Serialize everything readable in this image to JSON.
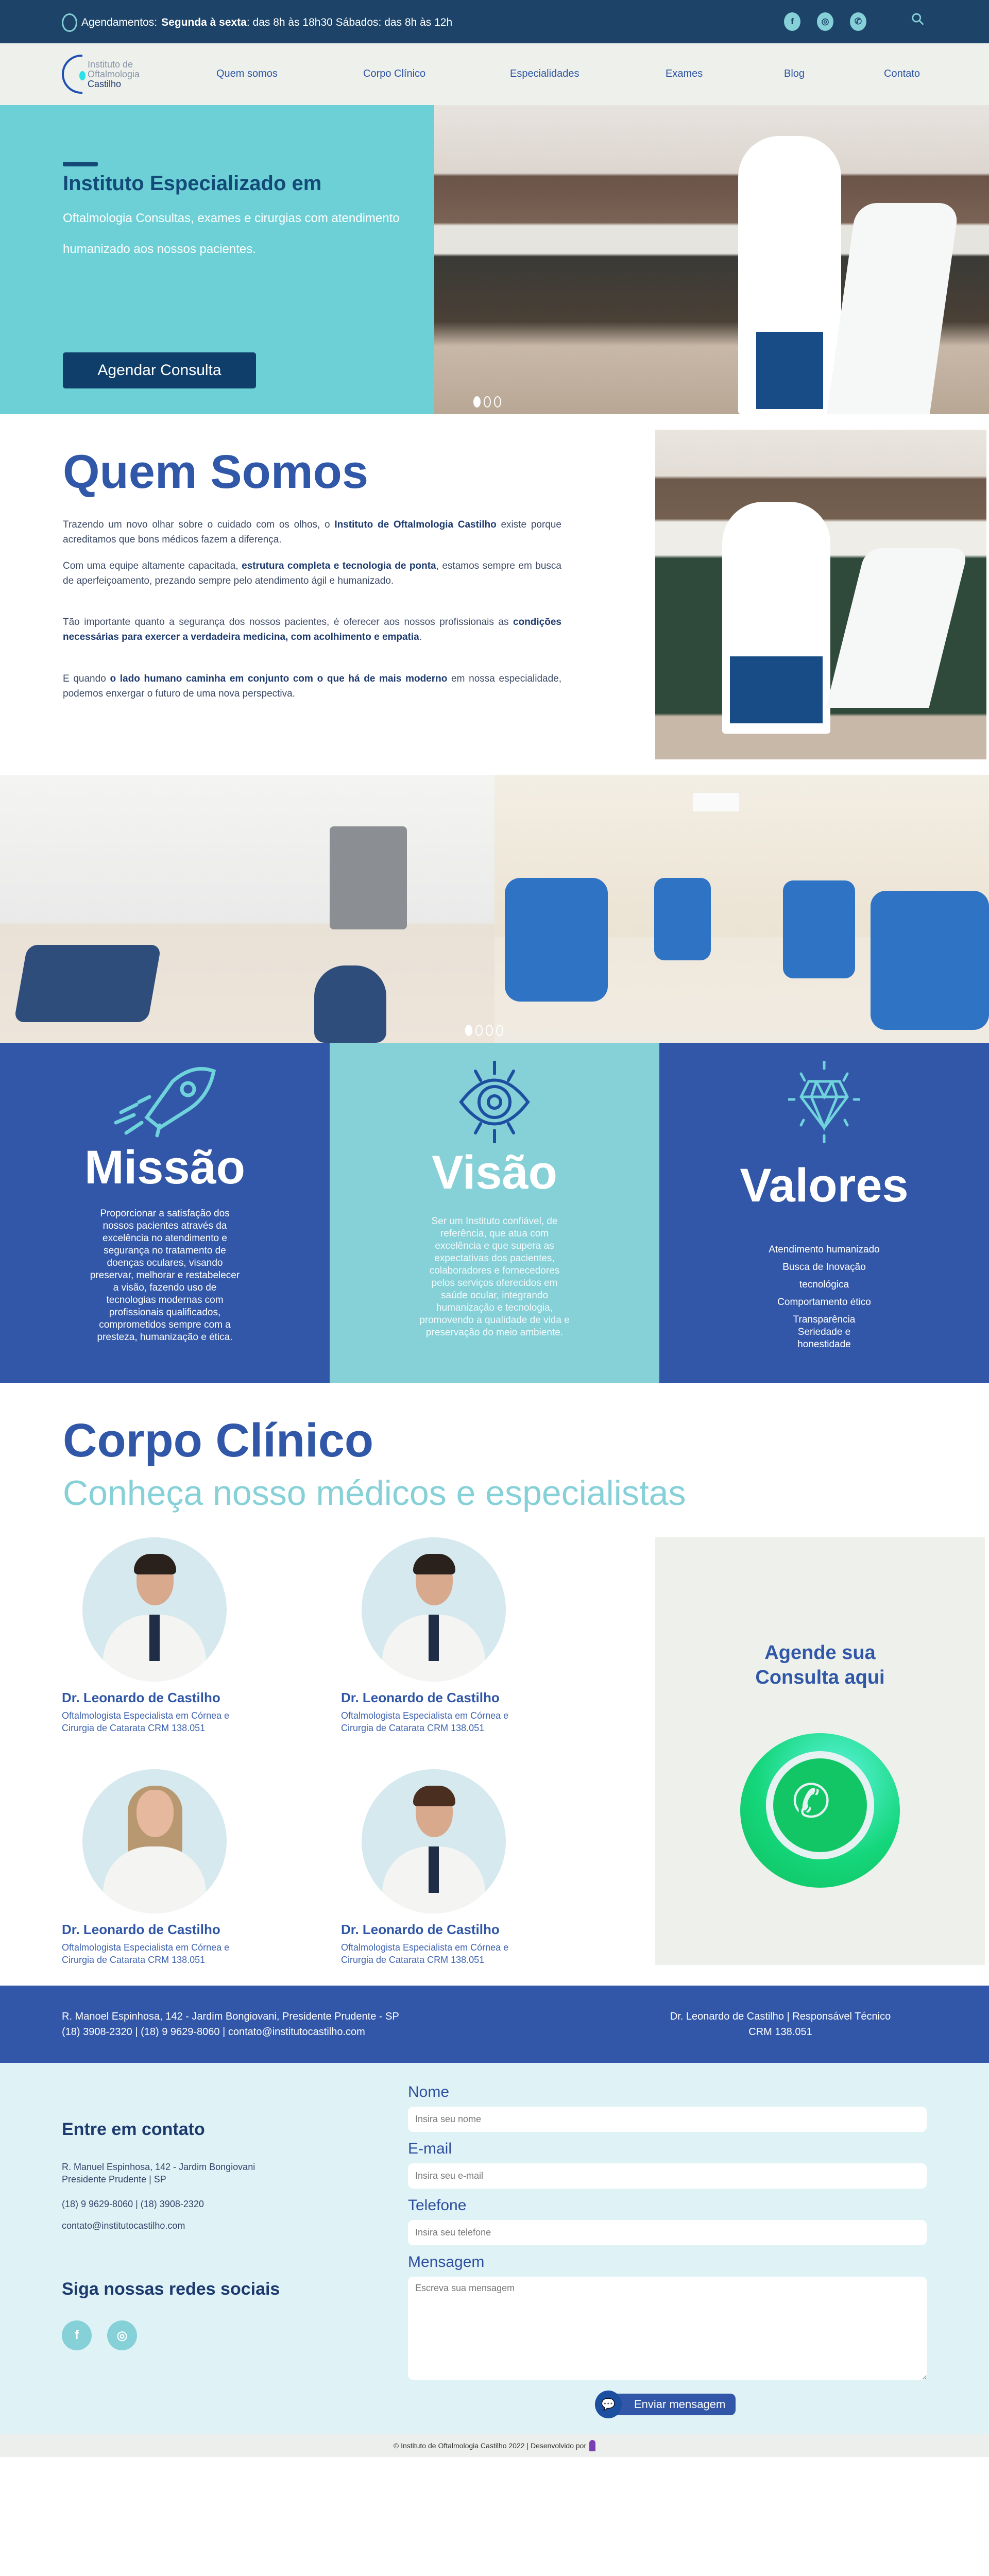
{
  "topbar": {
    "hours_label": "Agendamentos:",
    "hours_bold": "Segunda à sexta",
    "hours_rest": ": das 8h às 18h30 Sábados: das 8h às 12h",
    "social": [
      {
        "icon": "facebook-icon",
        "glyph": "f"
      },
      {
        "icon": "instagram-icon",
        "glyph": "◎"
      },
      {
        "icon": "whatsapp-icon",
        "glyph": "✆"
      }
    ],
    "search_glyph": "⚲"
  },
  "header": {
    "logo": {
      "line1": "Instituto de",
      "line2": "Oftalmologia",
      "line3": "Castilho"
    },
    "nav": [
      "Quem somos",
      "Corpo Clínico",
      "Especialidades",
      "Exames",
      "Blog",
      "Contato"
    ]
  },
  "hero": {
    "title": "Instituto Especializado em",
    "subtitle": "Oftalmologia Consultas, exames e cirurgias com atendimento humanizado aos nossos pacientes.",
    "cta": "Agendar Consulta",
    "slides": 3,
    "active_slide": 1
  },
  "about": {
    "title": "Quem Somos",
    "p1_a": "Trazendo um novo olhar sobre o cuidado com os olhos, o ",
    "p1_b": "Instituto de Oftalmologia Castilho",
    "p1_c": " existe porque acreditamos que bons médicos fazem a diferença.",
    "p2_a": "Com uma equipe altamente capacitada, ",
    "p2_b": "estrutura completa e tecnologia de ponta",
    "p2_c": ", estamos sempre em busca de aperfeiçoamento, prezando sempre pelo atendimento ágil e humanizado.",
    "p3_a": "Tão importante quanto a segurança dos nossos pacientes, é oferecer aos nossos profissionais as ",
    "p3_b": "condições necessárias para exercer a verdadeira medicina, com acolhimento e empatia",
    "p3_c": ".",
    "p4_a": "E quando ",
    "p4_b": "o lado humano caminha em conjunto com o que há de mais moderno",
    "p4_c": " em nossa especialidade, podemos enxergar o futuro de uma nova perspectiva."
  },
  "gallery": {
    "slides": 4,
    "active_slide": 1
  },
  "values": {
    "missao": {
      "title": "Missão",
      "text": "Proporcionar a satisfação dos nossos pacientes através da excelência no atendimento e segurança no tratamento de doenças oculares, visando preservar, melhorar e restabelecer a visão, fazendo uso de tecnologias modernas com profissionais qualificados, comprometidos sempre com a presteza, humanização e ética."
    },
    "visao": {
      "title": "Visão",
      "text": "Ser um Instituto confiável, de referência, que atua com excelência e que supera as expectativas dos pacientes, colaboradores e fornecedores pelos serviços oferecidos em saúde ocular, integrando humanização e tecnologia, promovendo a qualidade de vida e preservação do meio ambiente."
    },
    "valores": {
      "title": "Valores",
      "items": [
        "Atendimento humanizado",
        "Busca de Inovação",
        "tecnológica",
        "Comportamento ético",
        "Transparência Seriedade e honestidade"
      ]
    },
    "colors": {
      "blue": "#3357a8",
      "cyan": "#86d0d8"
    }
  },
  "team": {
    "title": "Corpo Clínico",
    "subtitle": "Conheça nosso médicos e especialistas",
    "doctors": [
      {
        "name": "Dr. Leonardo de Castilho",
        "desc": "Oftalmologista Especialista em Córnea e Cirurgia de Catarata CRM 138.051"
      },
      {
        "name": "Dr. Leonardo de Castilho",
        "desc": "Oftalmologista Especialista em Córnea e Cirurgia de Catarata CRM 138.051"
      },
      {
        "name": "Dr. Leonardo de Castilho",
        "desc": "Oftalmologista Especialista em Córnea e Cirurgia de Catarata CRM 138.051"
      },
      {
        "name": "Dr. Leonardo de Castilho",
        "desc": "Oftalmologista Especialista em Córnea e Cirurgia de Catarata CRM 138.051"
      }
    ],
    "cta_line1": "Agende sua",
    "cta_line2": "Consulta aqui"
  },
  "footer_info": {
    "address": "R. Manoel Espinhosa, 142 - Jardim Bongiovani, Presidente Prudente - SP",
    "contacts": "(18) 3908-2320 | (18) 9 9629-8060 | contato@institutocastilho.com",
    "responsible": "Dr. Leonardo de Castilho | Responsável Técnico",
    "crm": "CRM 138.051"
  },
  "contact": {
    "title": "Entre em contato",
    "address1": "R. Manuel Espinhosa, 142 - Jardim Bongiovani",
    "address2": "Presidente Prudente | SP",
    "phones": "(18) 9 9629-8060 | (18) 3908-2320",
    "email": "contato@institutocastilho.com",
    "social_title": "Siga nossas redes sociais",
    "form": {
      "name_label": "Nome",
      "name_placeholder": "Insira seu nome",
      "email_label": "E-mail",
      "email_placeholder": "Insira seu e-mail",
      "phone_label": "Telefone",
      "phone_placeholder": "Insira seu telefone",
      "message_label": "Mensagem",
      "message_placeholder": "Escreva sua mensagem",
      "submit": "Enviar mensagem"
    }
  },
  "copyright": "© Instituto de Oftalmologia Castilho 2022 | Desenvolvido por"
}
